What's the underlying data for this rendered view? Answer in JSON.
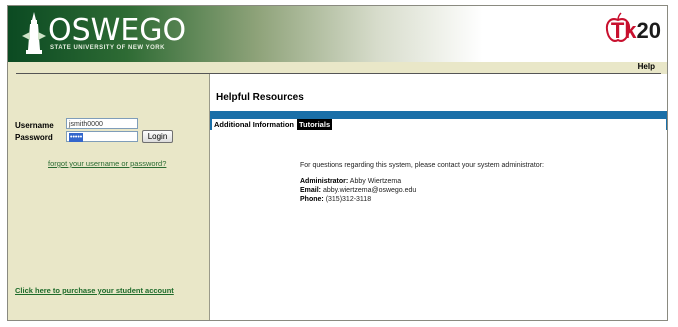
{
  "header": {
    "logo_text": "OSWEGO",
    "logo_subtext": "STATE UNIVERSITY OF NEW YORK",
    "tk_logo_prefix": "Tk",
    "tk_logo_suffix": "20",
    "help_label": "Help"
  },
  "login": {
    "username_label": "Username",
    "username_value": "jsmith0000",
    "password_label": "Password",
    "password_value": "•••••",
    "login_button": "Login",
    "forgot_link": "forgot your username or password?",
    "purchase_link": "Click here to purchase your student account"
  },
  "resources": {
    "title": "Helpful Resources",
    "tabs": [
      {
        "label": "Additional Information"
      },
      {
        "label": "Tutorials"
      }
    ],
    "intro": "For questions regarding this system, please contact your system administrator:",
    "administrator_label": "Administrator:",
    "administrator_value": "Abby Wiertzema",
    "email_label": "Email:",
    "email_value": "abby.wiertzema@oswego.edu",
    "phone_label": "Phone:",
    "phone_value": "(315)312-3118"
  },
  "colors": {
    "brand_green": "#0b4a22",
    "panel_beige": "#e9e7c8",
    "tab_blue": "#1a6fa8",
    "tk_red": "#c8102e"
  }
}
